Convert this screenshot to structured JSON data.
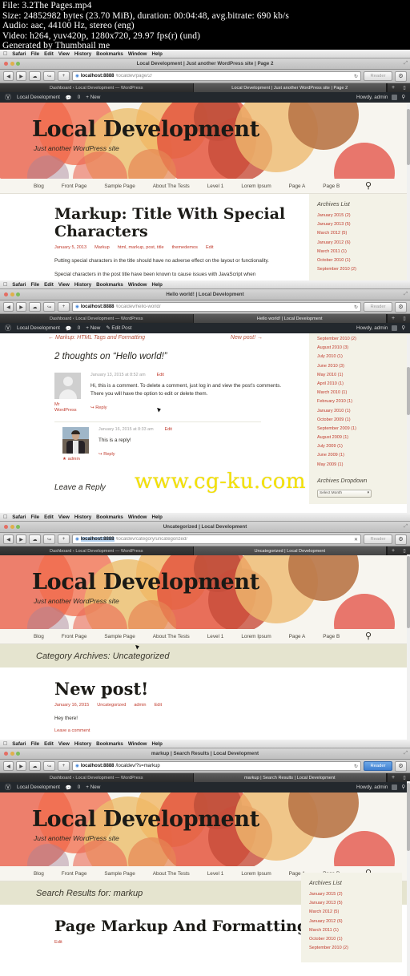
{
  "video_info": {
    "lines": [
      "File: 3.2The Pages.mp4",
      "Size: 24852982 bytes (23.70 MiB), duration: 00:04:48, avg.bitrate: 690 kb/s",
      "Audio: aac, 44100 Hz, stereo (eng)",
      "Video: h264, yuv420p, 1280x720, 29.97 fps(r) (und)",
      "Generated by Thumbnail me"
    ]
  },
  "watermark": "www.cg-ku.com",
  "menubar": {
    "apple": "apple-logo",
    "items": [
      "Safari",
      "File",
      "Edit",
      "View",
      "History",
      "Bookmarks",
      "Window",
      "Help"
    ]
  },
  "toolbar": {
    "back": "◀",
    "forward": "▶",
    "cloud": "☁",
    "share": "↪",
    "add": "+",
    "reload": "↻",
    "stop": "✕",
    "gear": "⚙",
    "reader_label": "Reader"
  },
  "site": {
    "title": "Local Development",
    "tagline": "Just another WordPress site",
    "nav": [
      "Blog",
      "Front Page",
      "Sample Page",
      "About The Tests",
      "Level 1",
      "Lorem Ipsum",
      "Page A",
      "Page B"
    ],
    "search_icon": "search-icon"
  },
  "adminbar": {
    "wp_icon": "wordpress-logo",
    "site_name": "Local Development",
    "comments_count": "0",
    "new_label": "New",
    "edit_post_label": "Edit Post",
    "howdy": "Howdy, admin"
  },
  "panels": [
    {
      "window_title": "Local Development | Just another WordPress site | Page 2",
      "url_host": "localhost:8888",
      "url_path": "/localdev/page/2/",
      "tabs": [
        {
          "label": "Dashboard ‹ Local Development — WordPress",
          "active": false
        },
        {
          "label": "Local Development | Just another WordPress site | Page 2",
          "active": true
        }
      ],
      "post": {
        "title": "Markup: Title With Special Characters",
        "meta": [
          "January 5, 2013",
          "Markup",
          "html, markup, post, title",
          "themedemos",
          "Edit"
        ],
        "paragraphs": [
          "Putting special characters in the title should have no adverse effect on the layout or functionality.",
          "Special characters in the post title have been known to cause issues with JavaScript when"
        ]
      },
      "sidebar": {
        "widget_title": "Archives List",
        "archives": [
          "January 2015 (2)",
          "January 2013 (5)",
          "March 2012 (5)",
          "January 2012 (6)",
          "March 2011 (1)",
          "October 2010 (1)",
          "September 2010 (2)"
        ]
      }
    },
    {
      "window_title": "Hello world! | Local Development",
      "url_host": "localhost:8888",
      "url_path": "/localdev/hello-world/",
      "tabs": [
        {
          "label": "Dashboard ‹ Local Development — WordPress",
          "active": false
        },
        {
          "label": "Hello world! | Local Development",
          "active": true
        }
      ],
      "post_nav": {
        "prev": "← Markup: HTML Tags and Formatting",
        "next": "New post! →"
      },
      "comments_heading": "2 thoughts on “Hello world!”",
      "comments": [
        {
          "author": "Mr WordPress",
          "avatar": "default-avatar",
          "date": "January 13, 2015 at 8:52 am",
          "edit": "Edit",
          "text": "Hi, this is a comment. To delete a comment, just log in and view the post’s comments. There you will have the option to edit or delete them.",
          "reply": "Reply"
        },
        {
          "author": "admin",
          "avatar": "user-photo",
          "date": "January 16, 2015 at 8:33 am",
          "edit": "Edit",
          "text": "This is a reply!",
          "reply": "Reply"
        }
      ],
      "leave_reply": "Leave a Reply",
      "sidebar": {
        "archives": [
          "September 2010 (2)",
          "August 2010 (3)",
          "July 2010 (1)",
          "June 2010 (3)",
          "May 2010 (1)",
          "April 2010 (1)",
          "March 2010 (1)",
          "February 2010 (1)",
          "January 2010 (1)",
          "October 2009 (1)",
          "September 2009 (1)",
          "August 2009 (1)",
          "July 2009 (1)",
          "June 2009 (1)",
          "May 2009 (1)"
        ],
        "dropdown_title": "Archives Dropdown",
        "dropdown_value": "Select Month"
      }
    },
    {
      "window_title": "Uncategorized | Local Development",
      "url_host": "localhost:8888",
      "url_path": "/localdev/category/uncategorized/",
      "url_selected": true,
      "tabs": [
        {
          "label": "Dashboard ‹ Local Development — WordPress",
          "active": false
        },
        {
          "label": "Uncategorized | Local Development",
          "active": true
        }
      ],
      "banner": "Category Archives: Uncategorized",
      "post": {
        "title": "New post!",
        "meta": [
          "January 16, 2015",
          "Uncategorized",
          "admin",
          "Edit"
        ],
        "paragraphs": [
          "Hey there!"
        ],
        "comment_link": "Leave a comment"
      }
    },
    {
      "window_title": "markup | Search Results | Local Development",
      "url_host": "localhost:8888",
      "url_path": "/localdev/?s=markup",
      "reader_active": true,
      "tabs": [
        {
          "label": "Dashboard ‹ Local Development — WordPress",
          "active": false
        },
        {
          "label": "markup | Search Results | Local Development",
          "active": true
        }
      ],
      "banner": "Search Results for: markup",
      "post": {
        "title": "Page Markup And Formatting",
        "meta": [
          "Edit"
        ]
      },
      "sidebar": {
        "widget_title": "Archives List",
        "archives": [
          "January 2015 (2)",
          "January 2013 (5)",
          "March 2012 (5)",
          "January 2012 (6)",
          "March 2011 (1)",
          "October 2010 (1)",
          "September 2010 (2)"
        ]
      }
    }
  ],
  "colors": {
    "accent_red": "#c0392b",
    "admin_bar": "#23282d",
    "banner": "#e5e4cf",
    "sidebar": "#f3f2e7",
    "watermark": "#f5e200"
  }
}
